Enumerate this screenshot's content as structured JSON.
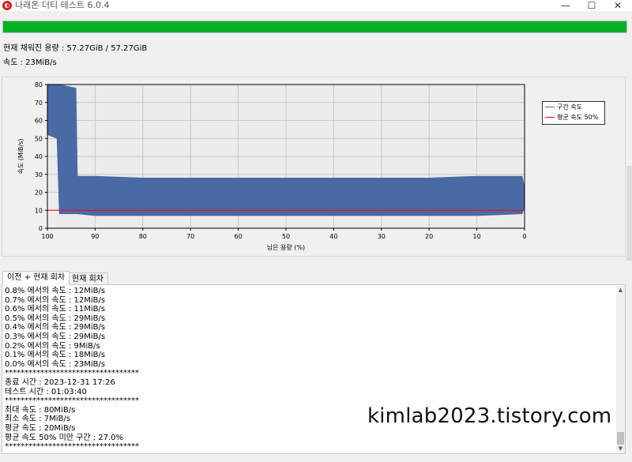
{
  "window": {
    "title": "나래온 더티 테스트 6.0.4",
    "app_icon_glyph": "◐",
    "minimize_glyph": "—",
    "maximize_glyph": "☐",
    "close_glyph": "✕"
  },
  "status": {
    "progress_fraction": 1.0,
    "progress_color": "#06b025",
    "capacity_text": "현재 채워진 용량 : 57.27GiB / 57.27GiB",
    "speed_text": "속도 : 23MiB/s"
  },
  "chart_data": {
    "type": "line",
    "title": "",
    "xlabel": "남은 용량 (%)",
    "ylabel": "속도 (MiB/s)",
    "xlim": [
      100,
      0
    ],
    "ylim": [
      0,
      80
    ],
    "x_ticks": [
      "100",
      "90",
      "80",
      "70",
      "60",
      "50",
      "40",
      "30",
      "20",
      "10",
      "0"
    ],
    "y_ticks": [
      "0",
      "10",
      "20",
      "30",
      "40",
      "50",
      "60",
      "70",
      "80"
    ],
    "grid": true,
    "legend_position": "right",
    "series": [
      {
        "name": "구간 속도",
        "color": "#4a6aa5",
        "band": [
          {
            "x": 100,
            "low": 52,
            "high": 80
          },
          {
            "x": 98,
            "low": 50,
            "high": 80
          },
          {
            "x": 97.5,
            "low": 8,
            "high": 80
          },
          {
            "x": 94,
            "low": 8,
            "high": 78
          },
          {
            "x": 93.7,
            "low": 8,
            "high": 29
          },
          {
            "x": 90,
            "low": 7,
            "high": 29
          },
          {
            "x": 80,
            "low": 7,
            "high": 28
          },
          {
            "x": 60,
            "low": 7,
            "high": 28
          },
          {
            "x": 40,
            "low": 7,
            "high": 28
          },
          {
            "x": 20,
            "low": 7,
            "high": 28
          },
          {
            "x": 10,
            "low": 7,
            "high": 29
          },
          {
            "x": 0.5,
            "low": 8,
            "high": 29
          },
          {
            "x": 0,
            "low": 12,
            "high": 23
          }
        ]
      },
      {
        "name": "평균 속도 50%",
        "color": "#ff0000",
        "values": [
          {
            "x": 100,
            "y": 10
          },
          {
            "x": 0,
            "y": 10
          }
        ]
      }
    ]
  },
  "tabs": [
    {
      "label": "이전 + 현재 회차",
      "active": true
    },
    {
      "label": "현재 회차",
      "active": false
    }
  ],
  "log": [
    "0.8% 에서의 속도 : 12MiB/s",
    "0.7% 에서의 속도 : 12MiB/s",
    "0.6% 에서의 속도 : 11MiB/s",
    "0.5% 에서의 속도 : 29MiB/s",
    "0.4% 에서의 속도 : 29MiB/s",
    "0.3% 에서의 속도 : 29MiB/s",
    "0.2% 에서의 속도 : 9MiB/s",
    "0.1% 에서의 속도 : 18MiB/s",
    "0.0% 에서의 속도 : 23MiB/s",
    "**********************************",
    "종료 시간 : 2023-12-31 17:26",
    "테스트 시간 : 01:03:40",
    "**********************************",
    "최대 속도 : 80MiB/s",
    "최소 속도 : 7MiB/s",
    "평균 속도 : 20MiB/s",
    "평균 속도 50% 미만 구간 : 27.0%",
    "**********************************"
  ],
  "scrollbar": {
    "up_glyph": "▲",
    "down_glyph": "▼"
  },
  "watermark": "kimlab2023.tistory.com"
}
